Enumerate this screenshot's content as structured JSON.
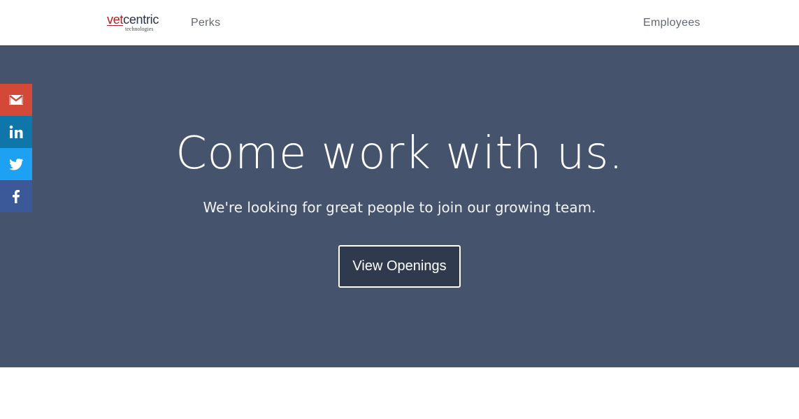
{
  "header": {
    "logo": {
      "primary_accent": "vet",
      "primary_rest": "centric",
      "secondary": "technologies"
    },
    "nav": {
      "perks": "Perks",
      "employees": "Employees"
    }
  },
  "hero": {
    "title": "Come work with us.",
    "subtitle": "We're looking for great people to join our growing team.",
    "cta": "View Openings"
  },
  "social": [
    {
      "icon": "gmail-icon",
      "color": "#d34836"
    },
    {
      "icon": "linkedin-icon",
      "color": "#0e76a8"
    },
    {
      "icon": "twitter-icon",
      "color": "#1da1f2"
    },
    {
      "icon": "facebook-icon",
      "color": "#3b5998"
    }
  ],
  "colors": {
    "hero_background": "#46536c",
    "button_background": "#2f3a4e",
    "logo_accent": "#b11f24",
    "nav_text": "#626772"
  }
}
